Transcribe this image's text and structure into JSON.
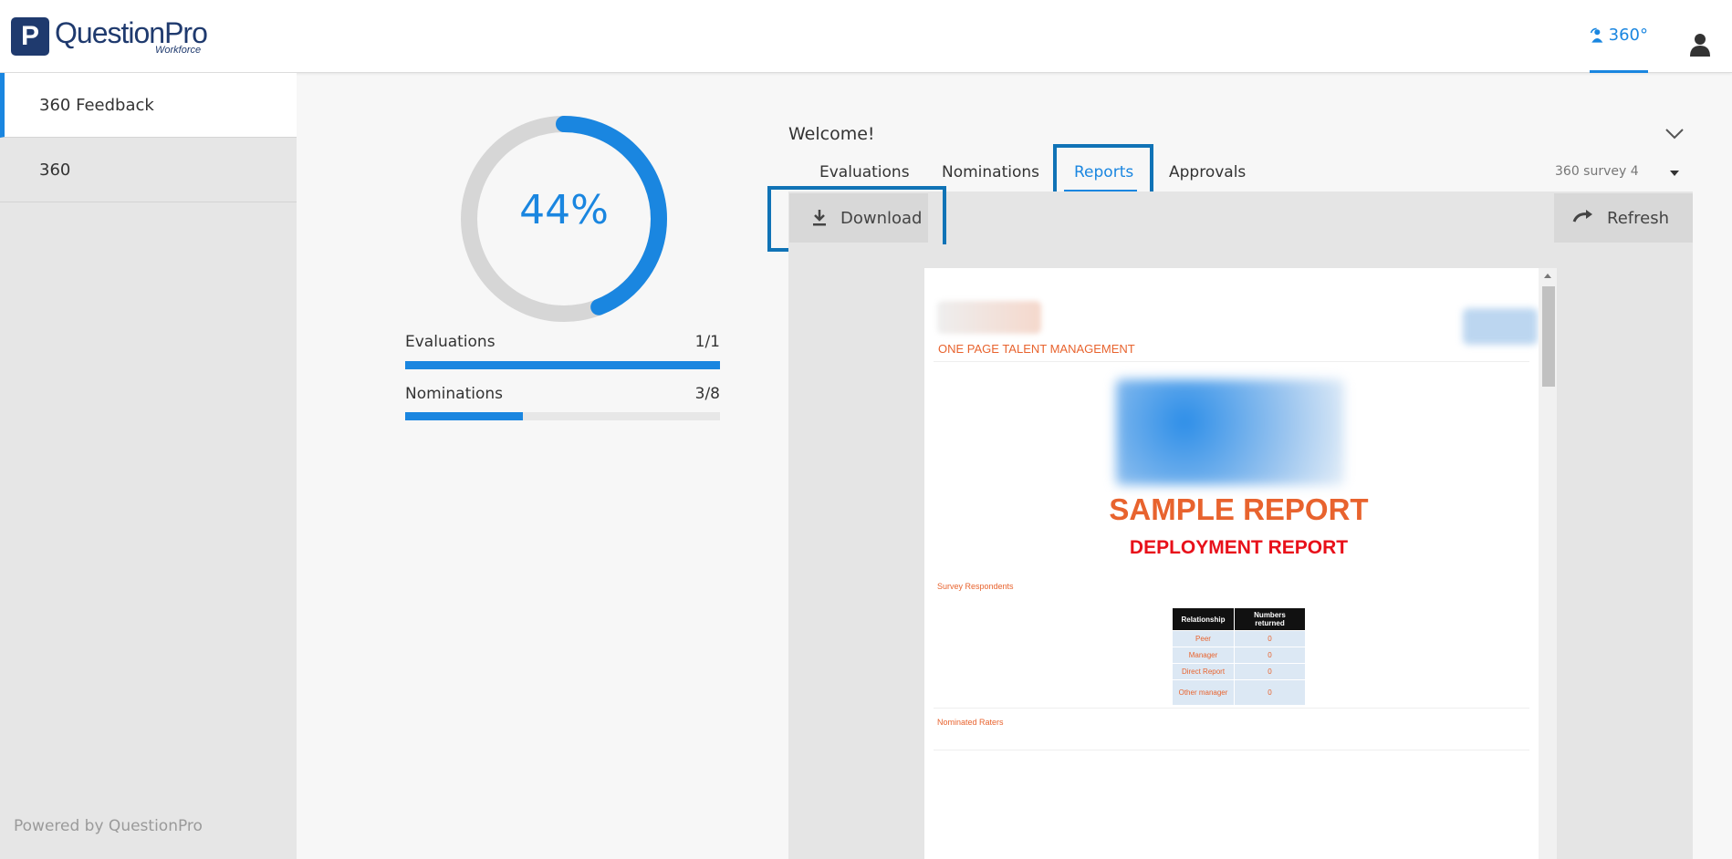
{
  "header": {
    "logo_letter": "P",
    "brand": "QuestionPro",
    "brand_sub": "Workforce",
    "module_label": "360°",
    "user_icon": "user-icon"
  },
  "sidebar": {
    "items": [
      {
        "label": "360 Feedback",
        "active": true
      },
      {
        "label": "360",
        "active": false
      }
    ],
    "powered_by": "Powered by QuestionPro"
  },
  "progress": {
    "percent_label": "44%",
    "percent": 44,
    "evaluations": {
      "label": "Evaluations",
      "value": "1/1",
      "fraction": 1.0
    },
    "nominations": {
      "label": "Nominations",
      "value": "3/8",
      "fraction": 0.375
    }
  },
  "main": {
    "welcome": "Welcome!",
    "tabs": [
      {
        "label": "Evaluations",
        "active": false
      },
      {
        "label": "Nominations",
        "active": false
      },
      {
        "label": "Reports",
        "active": true
      },
      {
        "label": "Approvals",
        "active": false
      }
    ],
    "survey_select": "360 survey 4",
    "download_label": "Download",
    "refresh_label": "Refresh"
  },
  "report": {
    "header_text": "ONE PAGE TALENT MANAGEMENT",
    "title": "SAMPLE REPORT",
    "subtitle": "DEPLOYMENT REPORT",
    "respondents_heading": "Survey Respondents",
    "table_headers": [
      "Relationship",
      "Numbers returned"
    ],
    "table_rows": [
      [
        "Peer",
        "0"
      ],
      [
        "Manager",
        "0"
      ],
      [
        "Direct Report",
        "0"
      ],
      [
        "Other manager",
        "0"
      ]
    ],
    "nominated_heading": "Nominated Raters"
  },
  "colors": {
    "accent": "#1a86e0",
    "highlight": "#1073b6",
    "report_orange": "#e8632e",
    "report_red": "#e8101a"
  }
}
